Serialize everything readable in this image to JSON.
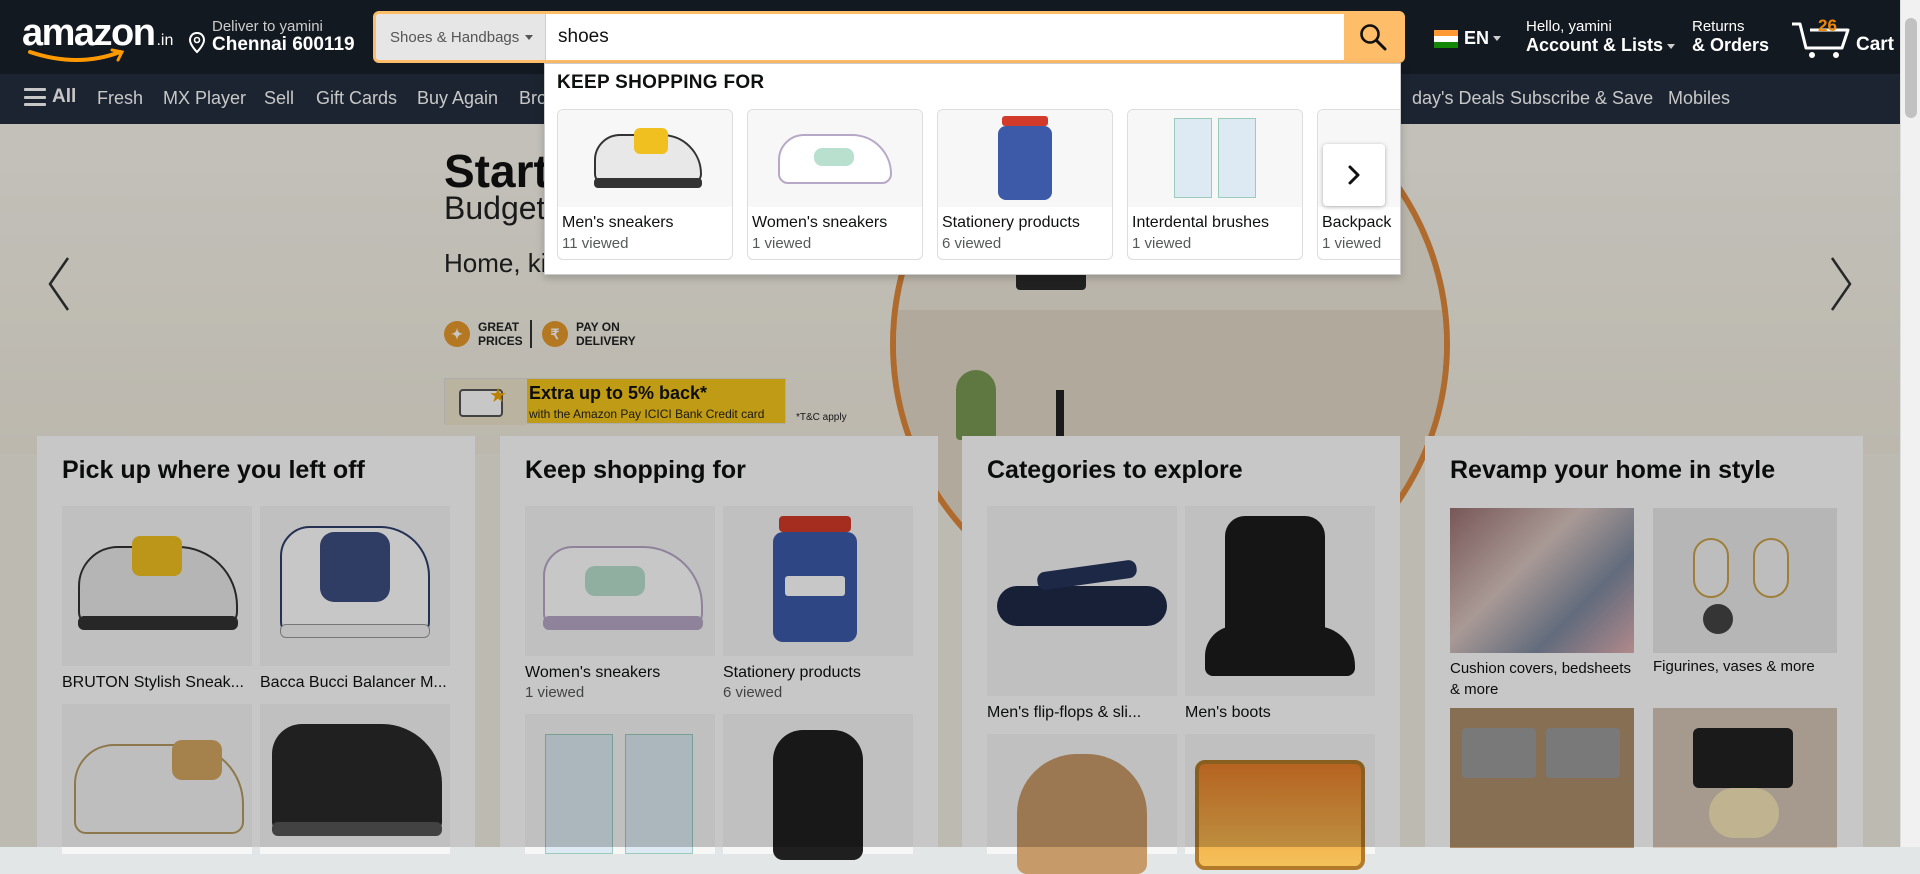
{
  "header": {
    "logo": "amazon",
    "logo_suffix": ".in",
    "deliver_line1": "Deliver to yamini",
    "deliver_line2": "Chennai 600119",
    "search_category": "Shoes & Handbags",
    "search_value": "shoes",
    "language": "EN",
    "account_line1": "Hello, yamini",
    "account_line2": "Account & Lists",
    "returns_line1": "Returns",
    "returns_line2": "& Orders",
    "cart_count": "26",
    "cart_label": "Cart"
  },
  "subnav": {
    "all": "All",
    "items": [
      "Fresh",
      "MX Player",
      "Sell",
      "Gift Cards",
      "Buy Again",
      "Bro",
      "day's Deals",
      "Subscribe & Save",
      "Mobiles"
    ]
  },
  "hero": {
    "title": "Start",
    "subtitle": "Budget",
    "line3": "Home, ki",
    "badge1_a": "GREAT",
    "badge1_b": "PRICES",
    "badge2_a": "PAY ON",
    "badge2_b": "DELIVERY",
    "promo_line1": "Extra up to 5% back*",
    "promo_line2": "with the Amazon Pay ICICI Bank Credit card",
    "tnc": "*T&C apply"
  },
  "dropdown": {
    "heading": "KEEP SHOPPING FOR",
    "items": [
      {
        "label": "Men's sneakers",
        "sub": "11 viewed"
      },
      {
        "label": "Women's sneakers",
        "sub": "1 viewed"
      },
      {
        "label": "Stationery products",
        "sub": "6 viewed"
      },
      {
        "label": "Interdental brushes",
        "sub": "1 viewed"
      },
      {
        "label": "Backpack",
        "sub": "1 viewed"
      }
    ]
  },
  "cards": {
    "card1": {
      "title": "Pick up where you left off",
      "items": [
        "BRUTON Stylish Sneak...",
        "Bacca Bucci Balancer M..."
      ]
    },
    "card2": {
      "title": "Keep shopping for",
      "items": [
        {
          "label": "Women's sneakers",
          "sub": "1 viewed"
        },
        {
          "label": "Stationery products",
          "sub": "6 viewed"
        }
      ]
    },
    "card3": {
      "title": "Categories to explore",
      "items": [
        "Men's flip-flops & sli...",
        "Men's boots"
      ]
    },
    "card4": {
      "title": "Revamp your home in style",
      "items": [
        "Cushion covers, bedsheets & more",
        "Figurines, vases & more"
      ]
    }
  }
}
